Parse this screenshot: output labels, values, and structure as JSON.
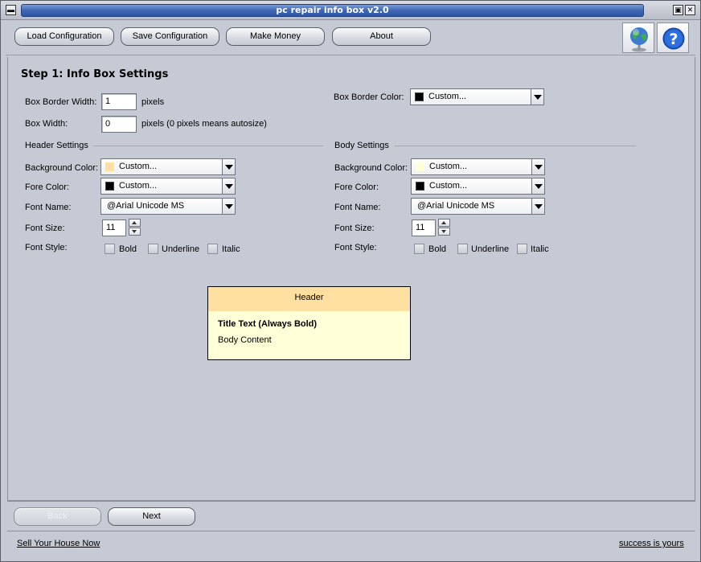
{
  "window": {
    "title": "pc repair info box v2.0",
    "minimize_glyph": "▬",
    "maximize_glyph": "▣",
    "close_glyph": "✕"
  },
  "toolbar": {
    "load_label": "Load Configuration",
    "save_label": "Save Configuration",
    "money_label": "Make Money",
    "about_label": "About",
    "globe_icon": "globe-icon",
    "help_icon": "help-icon"
  },
  "step": {
    "title": "Step 1: Info Box Settings"
  },
  "box": {
    "border_width_label": "Box Border Width:",
    "border_width_value": "1",
    "border_width_unit": "pixels",
    "width_label": "Box Width:",
    "width_value": "0",
    "width_unit": "pixels (0 pixels means autosize)",
    "border_color_label": "Box Border Color:",
    "border_color_value": "Custom...",
    "border_color_swatch": "#000000"
  },
  "header_settings": {
    "section_title": "Header Settings",
    "bg_label": "Background Color:",
    "bg_value": "Custom...",
    "bg_swatch": "#ffe0a0",
    "fore_label": "Fore Color:",
    "fore_value": "Custom...",
    "fore_swatch": "#000000",
    "font_label": "Font Name:",
    "font_value": "@Arial Unicode MS",
    "size_label": "Font Size:",
    "size_value": "11",
    "style_label": "Font Style:",
    "bold_label": "Bold",
    "underline_label": "Underline",
    "italic_label": "Italic"
  },
  "body_settings": {
    "section_title": "Body Settings",
    "bg_label": "Background Color:",
    "bg_value": "Custom...",
    "bg_swatch": "#ffffd8",
    "fore_label": "Fore Color:",
    "fore_value": "Custom...",
    "fore_swatch": "#000000",
    "font_label": "Font Name:",
    "font_value": "@Arial Unicode MS",
    "size_label": "Font Size:",
    "size_value": "11",
    "style_label": "Font Style:",
    "bold_label": "Bold",
    "underline_label": "Underline",
    "italic_label": "Italic"
  },
  "preview": {
    "header_text": "Header",
    "title_text": "Title Text (Always Bold)",
    "body_text": "Body Content"
  },
  "nav": {
    "back_label": "Back",
    "next_label": "Next"
  },
  "footer": {
    "left_link": "Sell Your House Now",
    "right_link": "success is yours"
  }
}
